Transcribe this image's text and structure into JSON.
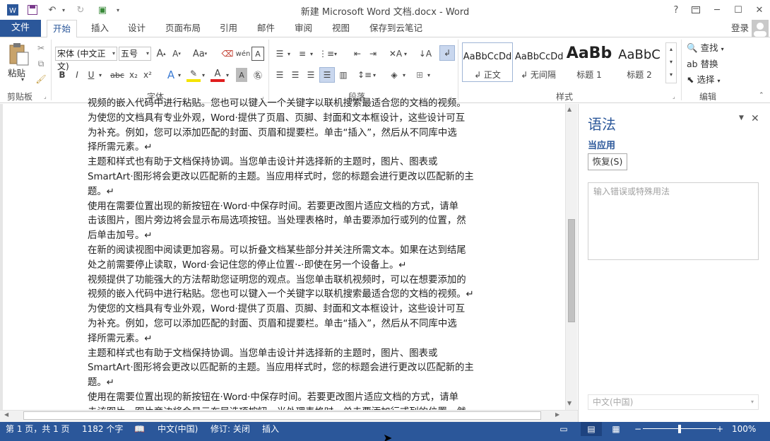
{
  "window": {
    "title": "新建 Microsoft Word 文档.docx - Word",
    "help_label": "?",
    "controls": [
      "minimize",
      "restore",
      "maximize",
      "close"
    ]
  },
  "tabs": {
    "file": "文件",
    "items": [
      "开始",
      "插入",
      "设计",
      "页面布局",
      "引用",
      "邮件",
      "审阅",
      "视图",
      "保存到云笔记"
    ],
    "active_index": 0,
    "login": "登录"
  },
  "ribbon": {
    "clipboard": {
      "label": "剪贴板",
      "paste": "粘贴"
    },
    "font": {
      "label": "字体",
      "font_name": "宋体 (中文正文)",
      "font_size": "五号",
      "grow": "A",
      "shrink": "A",
      "change_case": "Aa",
      "bold": "B",
      "italic": "I",
      "underline": "U",
      "strike": "abc",
      "sub": "x₂",
      "sup": "x²"
    },
    "paragraph": {
      "label": "段落"
    },
    "styles": {
      "label": "样式",
      "items": [
        {
          "sample": "AaBbCcDd",
          "name": "↲ 正文"
        },
        {
          "sample": "AaBbCcDd",
          "name": "↲ 无间隔"
        },
        {
          "sample": "AaBb",
          "name": "标题 1"
        },
        {
          "sample": "AaBbC",
          "name": "标题 2"
        }
      ]
    },
    "editing": {
      "label": "编辑",
      "find": "查找",
      "replace": "替换",
      "select": "选择"
    }
  },
  "document": {
    "lines": [
      {
        "text": "视频的嵌入代码中进行粘贴。您也可以键入一个关键字以联机搜索最适合您的文档的视频。"
      },
      {
        "text": "为使您的文档具有专业外观，Word·提供了页眉、页脚、封面和文本框设计，这些设计可互"
      },
      {
        "text": "为补充。例如，您可以添加匹配的封面、页眉和提要栏。单击“插入”，然后从不同库中选"
      },
      {
        "text": "择所需元素。↵"
      },
      {
        "text": "主题和样式也有助于文档保持协调。当您单击设计并选择新的主题时，图片、图表或"
      },
      {
        "text": "SmartArt·图形将会更改以匹配新的主题。当应用样式时，您的标题会进行更改以匹配新的主"
      },
      {
        "text": "题。↵"
      },
      {
        "text": "使用在需要位置出现的新按钮在·Word·中保存时间。若要更改图片适应文档的方式，请单"
      },
      {
        "text": "击该图片，图片旁边将会显示布局选项按钮。当处理表格时，单击要添加行或列的位置，然"
      },
      {
        "text": "后单击加号。↵"
      },
      {
        "text": "在新的阅读视图中阅读更加容易。可以折叠文档某些部分并关注所需文本。如果在达到结尾"
      },
      {
        "text": "处之前需要停止读取，Word·会记住您的停止位置·-·即使在另一个设备上。↵"
      },
      {
        "text": "视频提供了功能强大的方法帮助您证明您的观点。当您单击联机视频时，可以在想要添加的"
      },
      {
        "text": "视频的嵌入代码中进行粘贴。您也可以键入一个关键字以联机搜索最适合您的文档的视频。↵"
      },
      {
        "text": "为使您的文档具有专业外观，Word·提供了页眉、页脚、封面和文本框设计，这些设计可互"
      },
      {
        "text": "为补充。例如，您可以添加匹配的封面、页眉和提要栏。单击“插入”，然后从不同库中选"
      },
      {
        "text": "择所需元素。↵"
      },
      {
        "text": "主题和样式也有助于文档保持协调。当您单击设计并选择新的主题时，图片、图表或"
      },
      {
        "text": "SmartArt·图形将会更改以匹配新的主题。当应用样式时，您的标题会进行更改以匹配新的主"
      },
      {
        "text": "题。↵"
      },
      {
        "text": "使用在需要位置出现的新按钮在·Word·中保存时间。若要更改图片适应文档的方式，请单"
      },
      {
        "text": "击该图片，图片旁边将会显示布局选项按钮。当处理表格时，单击要添加行或列的位置，然"
      }
    ]
  },
  "pane": {
    "title": "语法",
    "subtitle": "当应用",
    "restore": "恢复(S)",
    "input_placeholder": "输入错误或特殊用法",
    "language": "中文(中国)"
  },
  "statusbar": {
    "page": "第 1 页，共 1 页",
    "words": "1182 个字",
    "language": "中文(中国)",
    "track": "修订: 关闭",
    "insert": "插入",
    "zoom": "100%",
    "zoom_level": 1.0
  },
  "colors": {
    "accent": "#2b579a",
    "wavy_underline": "#3b5fc6"
  }
}
